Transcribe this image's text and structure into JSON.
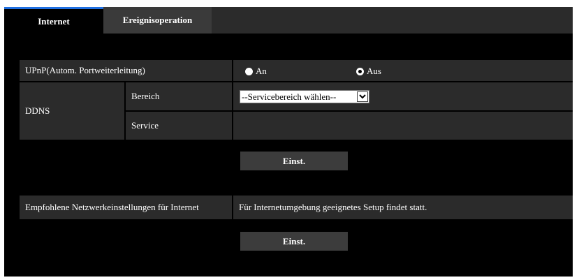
{
  "tabs": [
    {
      "label": "Internet",
      "active": true
    },
    {
      "label": "Ereignisoperation",
      "active": false
    }
  ],
  "upnp": {
    "label": "UPnP(Autom. Portweiterleitung)",
    "options": [
      {
        "label": "An",
        "selected": false
      },
      {
        "label": "Aus",
        "selected": true
      }
    ]
  },
  "ddns": {
    "label": "DDNS",
    "bereich_label": "Bereich",
    "service_label": "Service",
    "bereich_select": {
      "selected": "--Servicebereich wählen--"
    }
  },
  "buttons": {
    "set1": "Einst.",
    "set2": "Einst."
  },
  "recommended": {
    "label": "Empfohlene Netzwerkeinstellungen für Internet",
    "description": "Für Internetumgebung geeignetes Setup findet statt."
  },
  "colors": {
    "background": "#000000",
    "panel": "#2b2b2b",
    "button": "#3c3c3c",
    "active_tab_accent": "#1f6fe0"
  }
}
